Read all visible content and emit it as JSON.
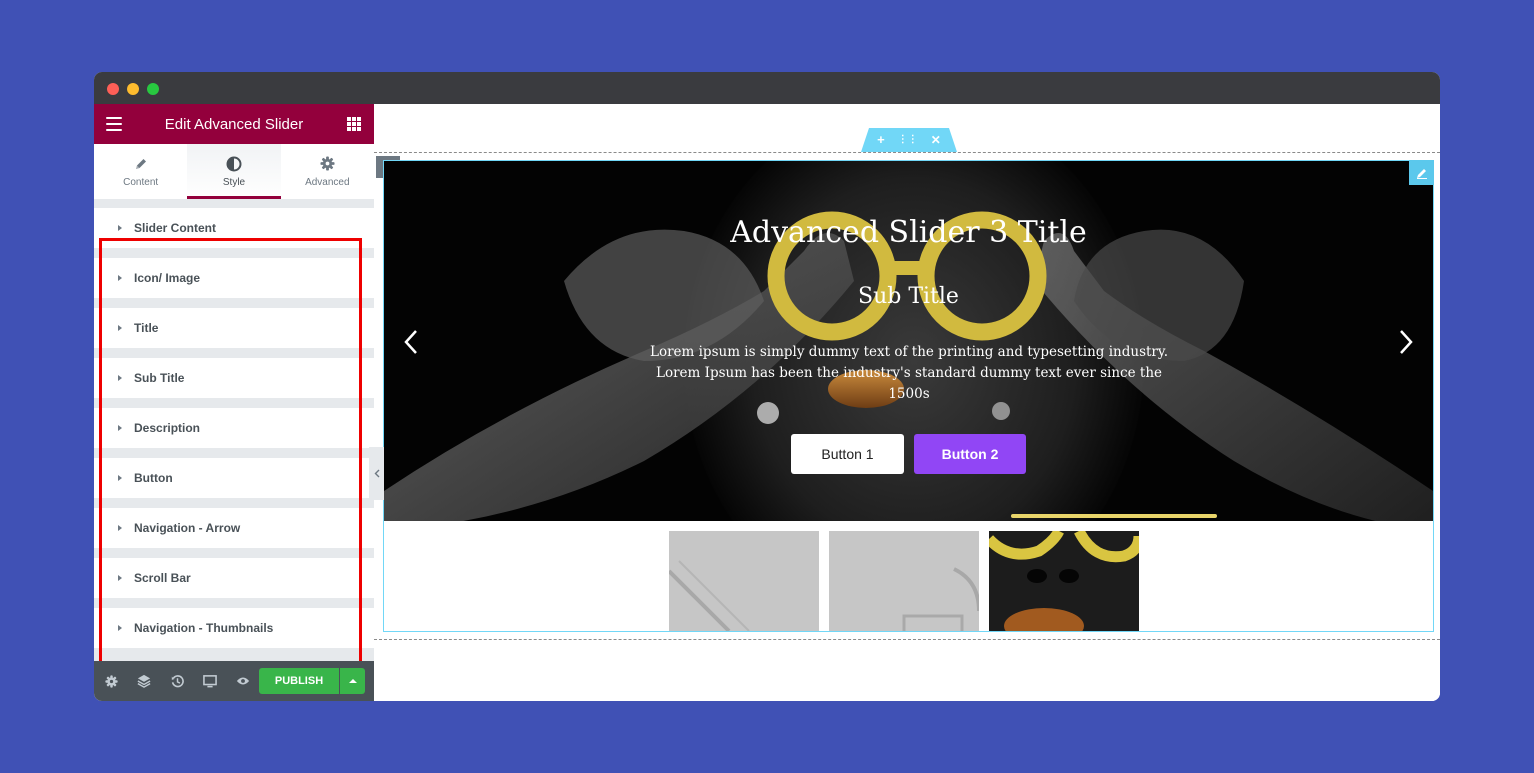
{
  "window": {
    "controls": [
      "close",
      "minimize",
      "maximize"
    ]
  },
  "panel": {
    "title": "Edit Advanced Slider",
    "menu_icon": "hamburger-icon",
    "apps_icon": "apps-grid-icon",
    "tabs": [
      {
        "label": "Content",
        "icon": "pencil-icon",
        "active": false
      },
      {
        "label": "Style",
        "icon": "contrast-icon",
        "active": true
      },
      {
        "label": "Advanced",
        "icon": "gear-icon",
        "active": false
      }
    ],
    "sections": [
      {
        "label": "Slider Content"
      },
      {
        "label": "Icon/ Image"
      },
      {
        "label": "Title"
      },
      {
        "label": "Sub Title"
      },
      {
        "label": "Description"
      },
      {
        "label": "Button"
      },
      {
        "label": "Navigation - Arrow"
      },
      {
        "label": "Scroll Bar"
      },
      {
        "label": "Navigation - Thumbnails"
      }
    ],
    "footer": {
      "icons": [
        "settings-icon",
        "layers-icon",
        "history-icon",
        "responsive-icon",
        "preview-icon"
      ],
      "publish_label": "PUBLISH"
    }
  },
  "canvas": {
    "section_handle": {
      "add": "+",
      "move": "⋮⋮",
      "close": "✕"
    },
    "slide": {
      "title": "Advanced Slider 3 Title",
      "subtitle": "Sub Title",
      "description": "Lorem ipsum is simply dummy text of the printing and typesetting industry. Lorem Ipsum has been the industry's standard dummy text ever since the 1500s",
      "button1": "Button 1",
      "button2": "Button 2"
    },
    "thumbnails_count": 3,
    "active_thumbnail": 3
  },
  "colors": {
    "background": "#4051b5",
    "panel_header": "#93003c",
    "publish": "#39b54a",
    "button2": "#9146f5",
    "widget_outline": "#71d7f7",
    "highlight": "#ee0000",
    "scrollbar": "#e9d56a"
  }
}
